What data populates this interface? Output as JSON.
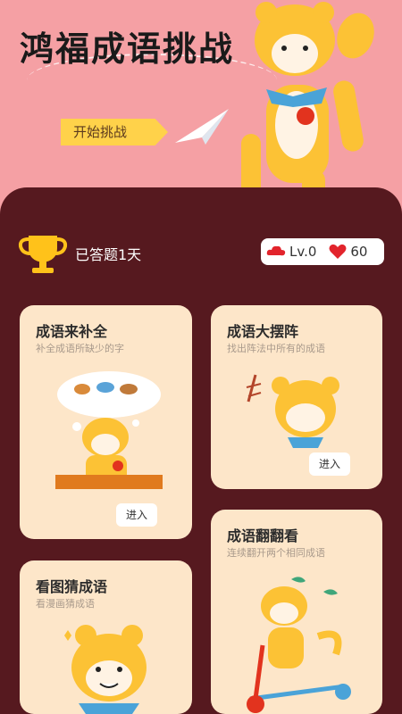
{
  "hero": {
    "title": "鸿福成语挑战",
    "start_label": "开始挑战"
  },
  "status": {
    "days": "已答题1天",
    "level": "Lv.0",
    "hearts": "60"
  },
  "cards": [
    {
      "title": "成语来补全",
      "subtitle": "补全成语所缺少的字",
      "enter": "进入"
    },
    {
      "title": "成语大摆阵",
      "subtitle": "找出阵法中所有的成语",
      "enter": "进入"
    },
    {
      "title": "成语翻翻看",
      "subtitle": "连续翻开两个相同成语"
    },
    {
      "title": "看图猜成语",
      "subtitle": "看漫画猜成语"
    }
  ],
  "colors": {
    "hero_bg": "#f5a0a4",
    "panel_bg": "#56191f",
    "card_bg": "#fde6c9",
    "accent": "#ffd24a",
    "heart": "#e2242c"
  },
  "icons": [
    "paper-plane-icon",
    "trophy-icon",
    "cloud-badge-icon",
    "heart-icon"
  ]
}
